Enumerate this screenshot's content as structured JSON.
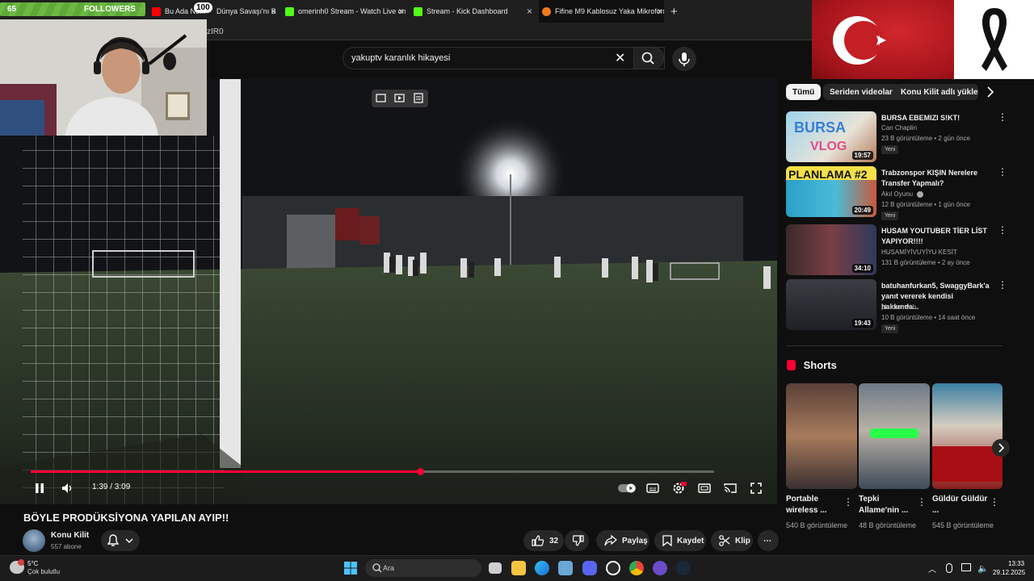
{
  "overlay": {
    "followers_count": "65",
    "followers_label": "FOLLOWERS",
    "goal_badge": "100"
  },
  "tabs": [
    {
      "label": "Bu Ada Ne...",
      "color": "#ff0000"
    },
    {
      "label": "Dünya Savaşı'nı B",
      "color": "#888888"
    },
    {
      "label": "omerinh0 Stream - Watch Live on",
      "color": "#53fc18"
    },
    {
      "label": "Stream - Kick Dashboard",
      "color": "#53fc18"
    },
    {
      "label": "Fifine M9 Kablosuz Yaka Mikrofon",
      "color": "#f27a1a"
    }
  ],
  "new_tab": "+",
  "url_fragment": "zIR0",
  "search": {
    "query": "yakuptv karanlık hikayesi"
  },
  "player": {
    "current_time": "1:39",
    "duration": "3:09",
    "time_display": "1:39 / 3:09",
    "progress": 0.57
  },
  "video": {
    "title": "BÖYLE PRODÜKSİYONA YAPILAN AYIP!!",
    "channel": "Konu Kilit",
    "subscribers": "557 abone"
  },
  "actions": {
    "likes": "32",
    "share": "Paylaş",
    "save": "Kaydet",
    "clip": "Klip",
    "more": "⋯"
  },
  "chips": [
    "Tümü",
    "Seriden videolar",
    "Konu Kilit adlı yükleyici"
  ],
  "recommendations": [
    {
      "title": "BURSA EBEMIZI S!KT!",
      "channel": "Can Chaplin",
      "meta": "23 B görüntüleme • 2 gün önce",
      "duration": "19:57",
      "badge": "Yeni"
    },
    {
      "title": "Trabzonspor KIŞIN Nerelere Transfer Yapmalı?",
      "channel": "Akıl Oyunu",
      "meta": "12 B görüntüleme • 1 gün önce",
      "duration": "20:49",
      "badge": "Yeni"
    },
    {
      "title": "HUSAM YOUTUBER TİER LİST YAPIYOR!!!!",
      "channel": "HUSAMİYİVUYİYU KESİT",
      "meta": "131 B görüntüleme • 2 ay önce",
      "duration": "34:10",
      "badge": ""
    },
    {
      "title": "batuhanfurkan5, SwaggyBark'a yanıt vererek kendisi hakkında...",
      "channel": "platcornweb",
      "meta": "10 B görüntüleme • 14 saat önce",
      "duration": "19:43",
      "badge": "Yeni"
    }
  ],
  "shorts": {
    "heading": "Shorts",
    "items": [
      {
        "title": "Portable wireless ...",
        "views": "540 B görüntüleme"
      },
      {
        "title": "Tepki Allame'nin ...",
        "views": "48 B görüntüleme"
      },
      {
        "title": "Güldür Güldür ...",
        "views": "545 B görüntüleme"
      }
    ]
  },
  "taskbar": {
    "temperature": "5°C",
    "weather": "Çok bulutlu",
    "search_label": "Ara",
    "time": "13:33",
    "date": "29.12.2025"
  }
}
